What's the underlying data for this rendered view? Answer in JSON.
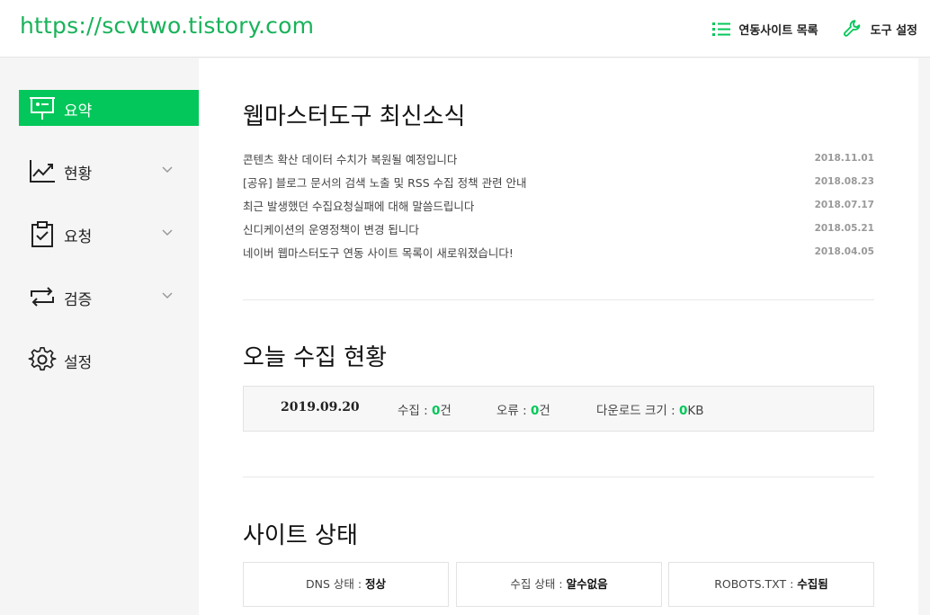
{
  "header": {
    "site_url": "https://scvtwo.tistory.com",
    "linked_sites_label": "연동사이트 목록",
    "tool_settings_label": "도구 설정"
  },
  "sidebar": {
    "items": [
      {
        "label": "요약",
        "icon": "presentation-board-icon",
        "active": true
      },
      {
        "label": "현황",
        "icon": "trend-chart-icon",
        "active": false
      },
      {
        "label": "요청",
        "icon": "clipboard-check-icon",
        "active": false
      },
      {
        "label": "검증",
        "icon": "refresh-arrows-icon",
        "active": false
      },
      {
        "label": "설정",
        "icon": "gear-icon",
        "active": false
      }
    ]
  },
  "news": {
    "title": "웹마스터도구 최신소식",
    "items": [
      {
        "title": "콘텐츠 확산 데이터 수치가 복원될 예정입니다",
        "date": "2018.11.01"
      },
      {
        "title": "[공유] 블로그 문서의 검색 노출 및 RSS 수집 정책 관련 안내",
        "date": "2018.08.23"
      },
      {
        "title": "최근 발생했던 수집요청실패에 대해 말씀드립니다",
        "date": "2018.07.17"
      },
      {
        "title": "신디케이션의 운영정책이 변경 됩니다",
        "date": "2018.05.21"
      },
      {
        "title": "네이버 웹마스터도구 연동 사이트 목록이 새로워졌습니다!",
        "date": "2018.04.05"
      }
    ]
  },
  "today": {
    "title": "오늘 수집 현황",
    "date": "2019.09.20",
    "collect_label": "수집 : ",
    "collect_value": "0",
    "collect_unit": "건",
    "error_label": "오류 : ",
    "error_value": "0",
    "error_unit": "건",
    "download_label": "다운로드 크기 : ",
    "download_value": "0",
    "download_unit": "KB"
  },
  "site_status": {
    "title": "사이트 상태",
    "dns_label": "DNS 상태 : ",
    "dns_value": "정상",
    "collect_label": "수집 상태 : ",
    "collect_value": "알수없음",
    "robots_label": "ROBOTS.TXT : ",
    "robots_value": "수집됨"
  },
  "colors": {
    "accent": "#03c75a",
    "url": "#19b25a"
  }
}
